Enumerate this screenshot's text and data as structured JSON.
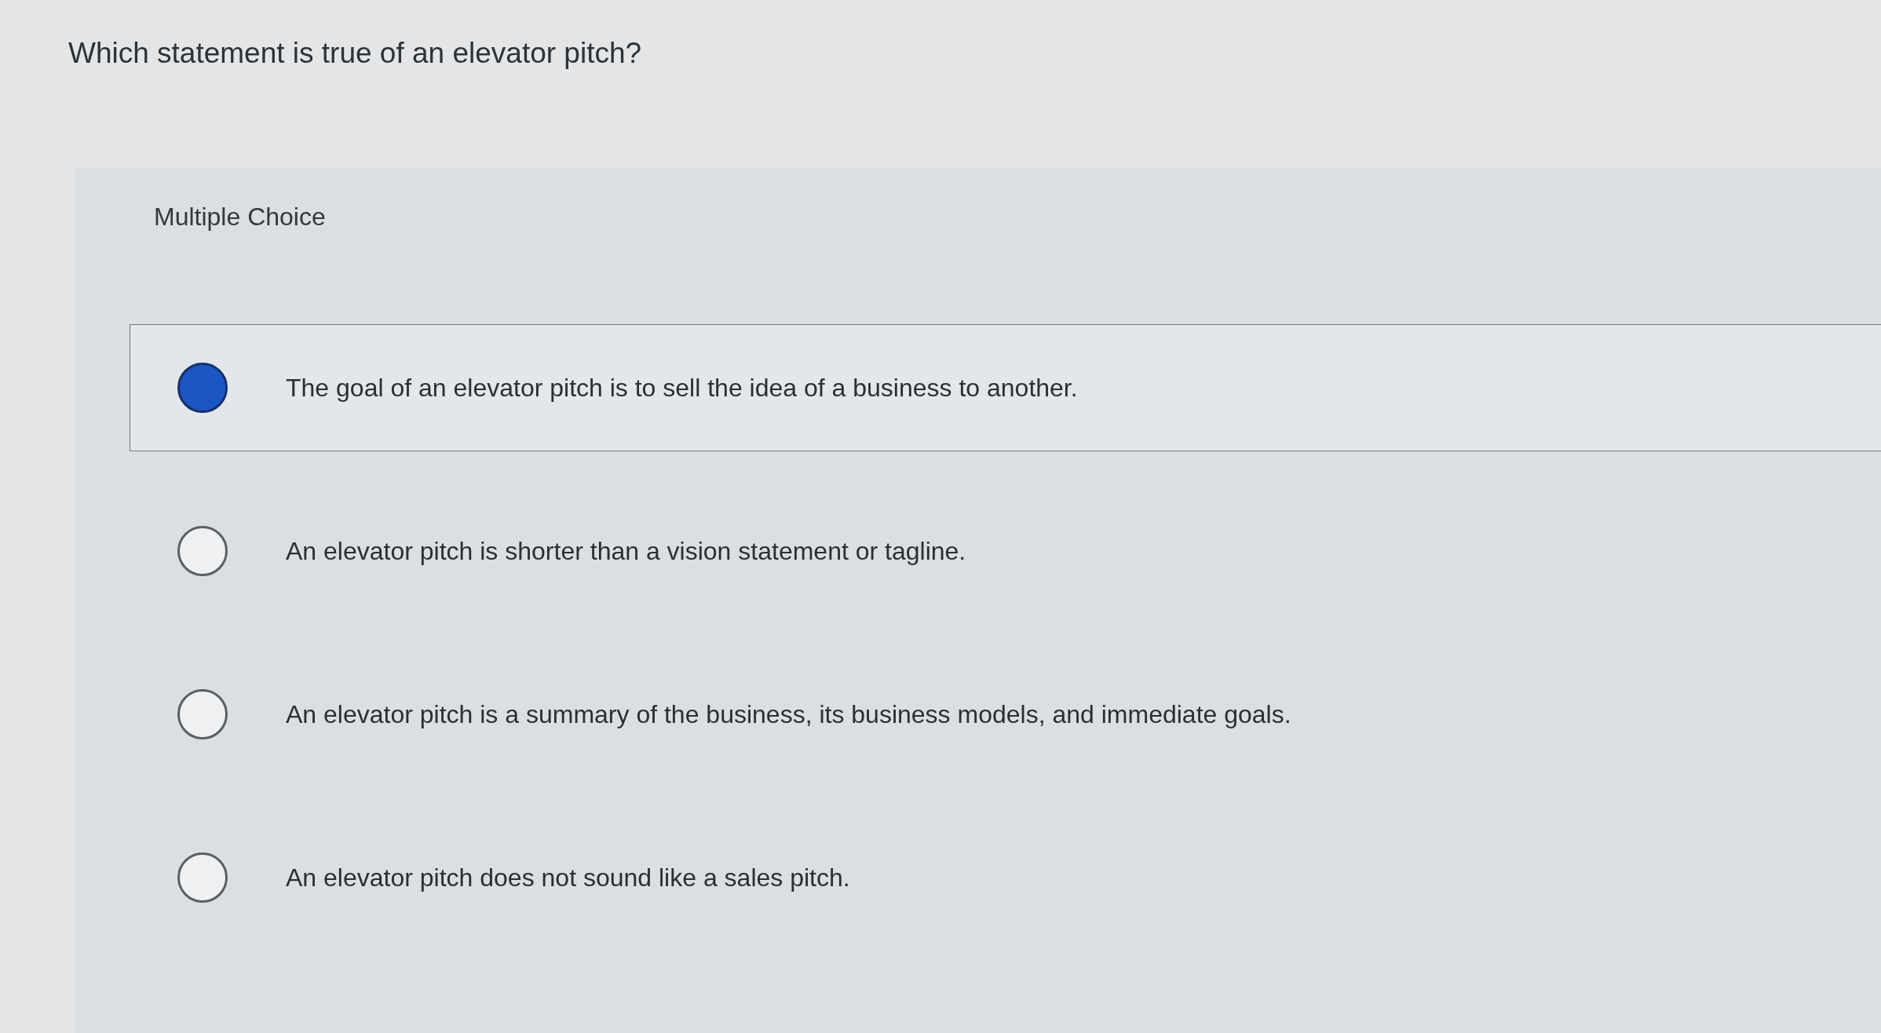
{
  "question": "Which statement is true of an elevator pitch?",
  "section_label": "Multiple Choice",
  "options": [
    {
      "text": "The goal of an elevator pitch is to sell the idea of a business to another.",
      "selected": true
    },
    {
      "text": "An elevator pitch is shorter than a vision statement or tagline.",
      "selected": false
    },
    {
      "text": "An elevator pitch is a summary of the business, its business models, and immediate goals.",
      "selected": false
    },
    {
      "text": "An elevator pitch does not sound like a sales pitch.",
      "selected": false
    }
  ]
}
